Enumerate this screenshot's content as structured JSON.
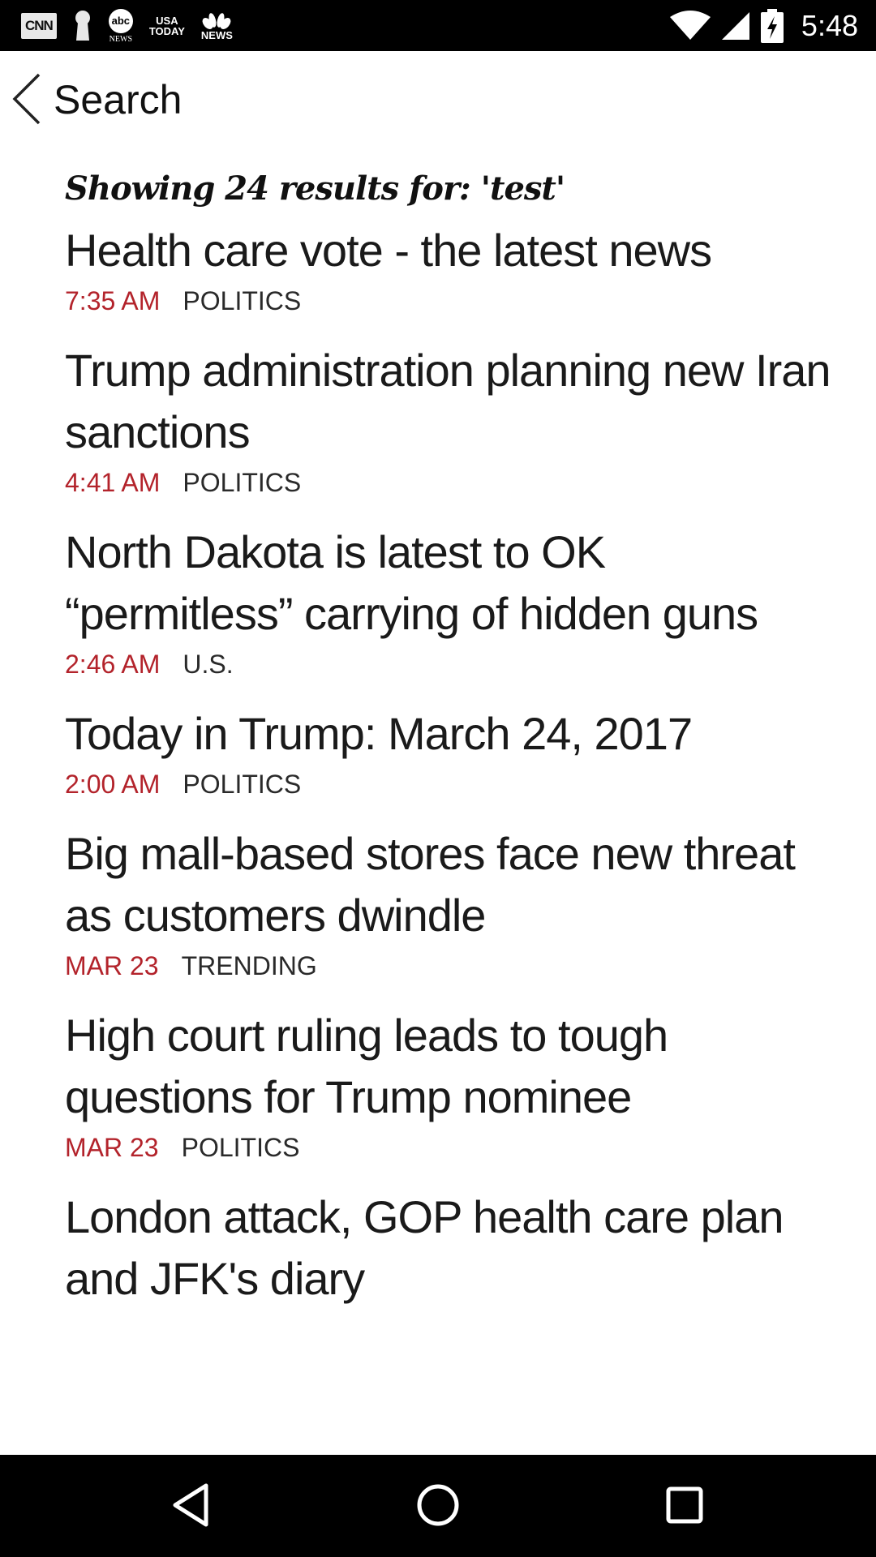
{
  "status_bar": {
    "time": "5:48",
    "icons": [
      "cnn-icon",
      "keyhole-icon",
      "abc-news-icon",
      "usa-today-icon",
      "nbc-news-icon",
      "wifi-icon",
      "signal-icon",
      "battery-charging-icon"
    ],
    "cnn_label": "CNN",
    "abc_label": "abc",
    "abc_sub": "NEWS",
    "usa_line1": "USA",
    "usa_line2": "TODAY",
    "nbc_label": "NEWS"
  },
  "app_bar": {
    "back_icon": "chevron-left-icon",
    "title": "Search"
  },
  "results": {
    "summary": "Showing 24 results for: 'test'",
    "items": [
      {
        "headline": "Health care vote - the latest news",
        "time": "7:35 AM",
        "section": "POLITICS"
      },
      {
        "headline": "Trump administration planning new Iran sanctions",
        "time": "4:41 AM",
        "section": "POLITICS"
      },
      {
        "headline": "North Dakota is latest to OK “permitless” carrying of hidden guns",
        "time": "2:46 AM",
        "section": "U.S."
      },
      {
        "headline": "Today in Trump: March 24, 2017",
        "time": "2:00 AM",
        "section": "POLITICS"
      },
      {
        "headline": "Big mall-based stores face new threat as customers dwindle",
        "time": "MAR 23",
        "section": "TRENDING"
      },
      {
        "headline": "High court ruling leads to tough questions for Trump nominee",
        "time": "MAR 23",
        "section": "POLITICS"
      },
      {
        "headline": "London attack, GOP health care plan and JFK's diary",
        "time": "",
        "section": ""
      }
    ]
  },
  "nav_bar": {
    "icons": [
      "back-triangle-icon",
      "home-circle-icon",
      "recents-square-icon"
    ]
  },
  "colors": {
    "accent": "#b3232b",
    "text": "#1a1a1a",
    "bars": "#000000"
  }
}
